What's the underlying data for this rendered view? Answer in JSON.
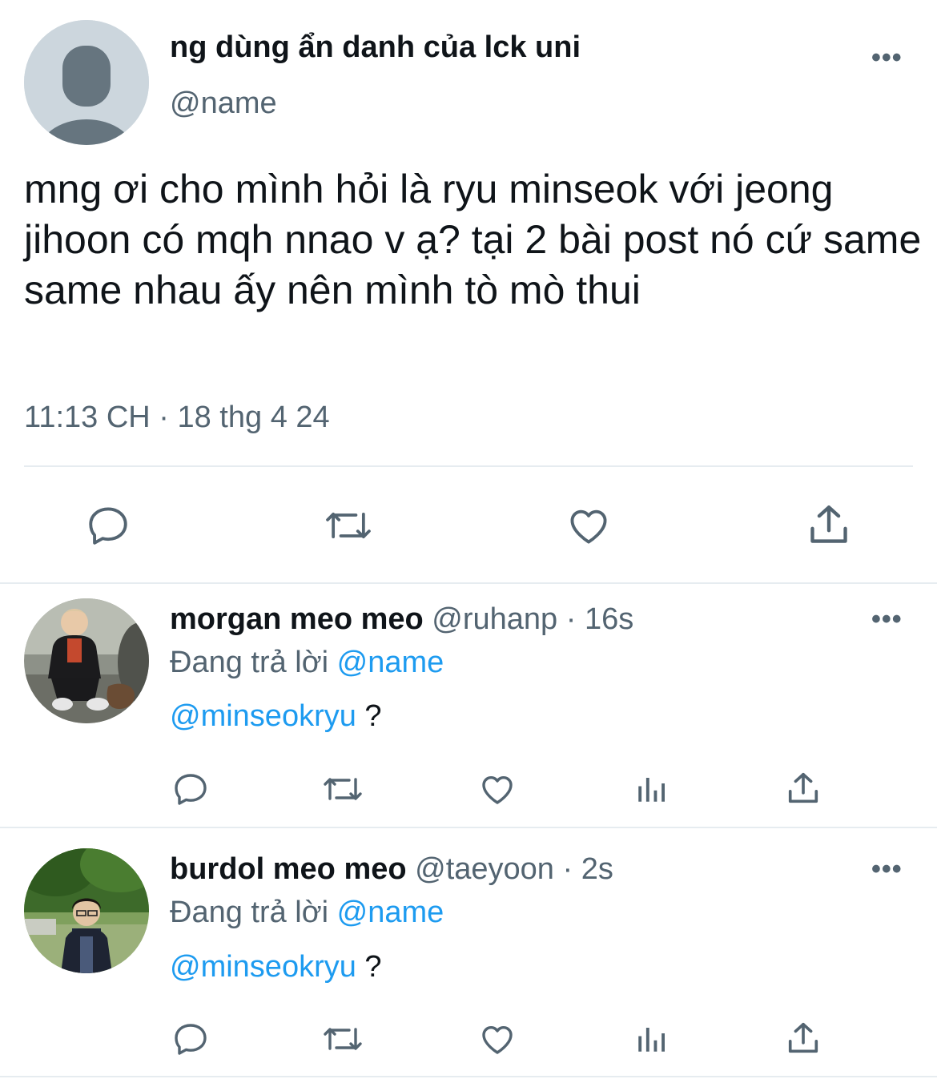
{
  "main_tweet": {
    "display_name": "ng dùng ẩn danh của lck uni",
    "handle": "@name",
    "text": "mng ơi cho mình hỏi là ryu minseok với jeong jihoon có mqh nnao v ạ? tại 2 bài post nó cứ same same nhau ấy nên mình tò mò thui",
    "timestamp": "11:13 CH · 18 thg 4 24",
    "more_label": "•••"
  },
  "replies": [
    {
      "display_name": "morgan meo meo",
      "handle_time": "@ruhanp · 16s",
      "replying_prefix": "Đang trả lời",
      "replying_to": "@name",
      "mention": "@minseokryu",
      "text": " ?",
      "more_label": "•••"
    },
    {
      "display_name": "burdol meo meo",
      "handle_time": "@taeyoon · 2s",
      "replying_prefix": "Đang trả lời",
      "replying_to": "@name",
      "mention": "@minseokryu",
      "text": " ?",
      "more_label": "•••"
    }
  ],
  "icons": {
    "reply": "reply-icon",
    "retweet": "retweet-icon",
    "like": "heart-icon",
    "share": "share-icon",
    "views": "analytics-icon"
  },
  "colors": {
    "text": "#0f1419",
    "secondary": "#536471",
    "accent": "#1d9bf0",
    "divider": "#e6ecf0"
  }
}
